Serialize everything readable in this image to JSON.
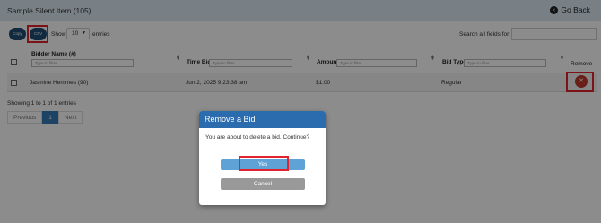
{
  "header": {
    "title": "Sample Silent Item (105)",
    "go_back_label": "Go Back",
    "go_back_icon": "circle-arrow-left-icon"
  },
  "toolbar": {
    "copy_label": "Copy",
    "csv_label": "CSV",
    "show_label": "Show",
    "page_length": "10",
    "entries_label": "entries",
    "search_label": "Search all fields for:",
    "search_value": ""
  },
  "table": {
    "columns": [
      {
        "label": "Bidder Name (#)",
        "filter_placeholder": "Type to filter"
      },
      {
        "label": "Time Bid",
        "filter_placeholder": "Type to filter"
      },
      {
        "label": "Amount",
        "filter_placeholder": "Type to filter"
      },
      {
        "label": "Bid Type",
        "filter_placeholder": "Type to filter"
      },
      {
        "label": "Remove",
        "filter_placeholder": ""
      }
    ],
    "rows": [
      {
        "bidder": "Jasmine Hemmes (90)",
        "time": "Jun 2, 2025 9:23:38 am",
        "amount": "$1.00",
        "bid_type": "Regular",
        "remove_icon": "x-icon"
      }
    ]
  },
  "footer": {
    "showing": "Showing 1 to 1 of 1 entries",
    "previous": "Previous",
    "page": "1",
    "next": "Next"
  },
  "modal": {
    "title": "Remove a Bid",
    "message": "You are about to delete a bid. Continue?",
    "yes_label": "Yes",
    "cancel_label": "Cancel"
  },
  "colors": {
    "header_bg": "#dde9f2",
    "primary": "#1f4e75",
    "modal_header": "#2b6cae",
    "yes_button": "#5fa3d6",
    "cancel_button": "#999999",
    "remove_button": "#c0392b",
    "highlight": "#e0242f"
  }
}
